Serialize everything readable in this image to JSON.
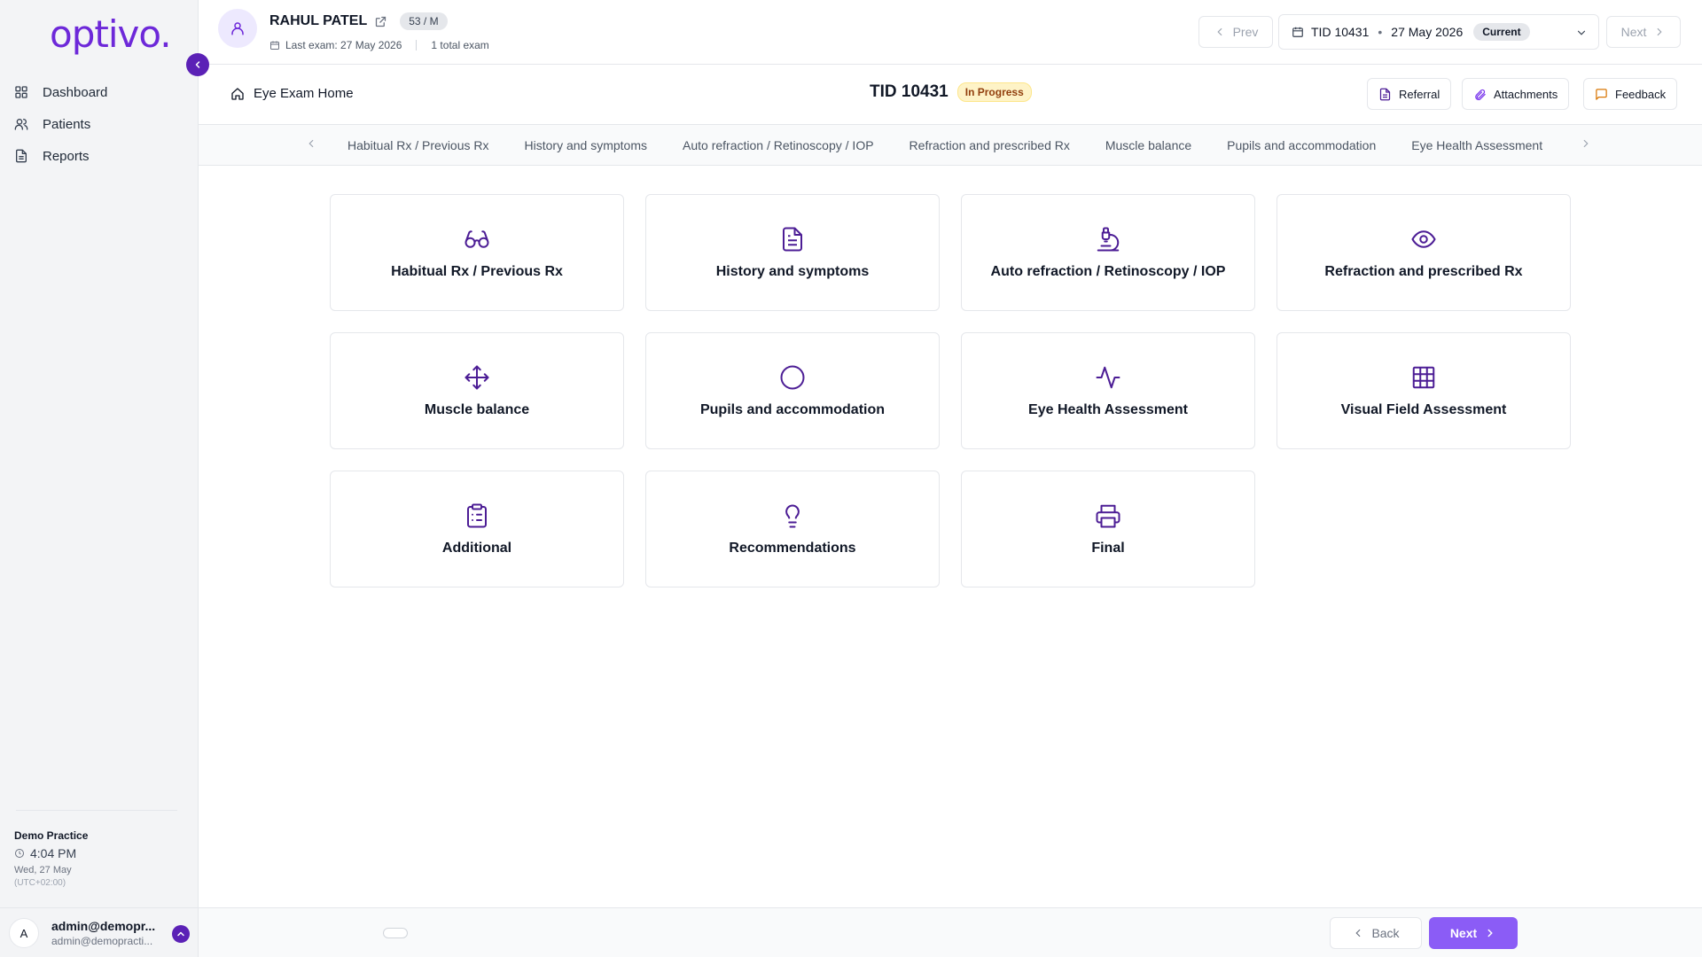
{
  "app": {
    "logo": "optivo."
  },
  "colors": {
    "accent": "#5b21b6",
    "icon": "#4c1d95",
    "primary_button": "#8b5cf6"
  },
  "sidebar": {
    "items": [
      {
        "label": "Dashboard",
        "icon": "grid-icon"
      },
      {
        "label": "Patients",
        "icon": "users-icon"
      },
      {
        "label": "Reports",
        "icon": "file-icon"
      }
    ],
    "practice": {
      "name": "Demo Practice",
      "time": "4:04 PM",
      "date": "Wed, 27 May",
      "tz": "(UTC+02:00)"
    },
    "user": {
      "initial": "A",
      "name": "admin@demopr...",
      "email": "admin@demopracti..."
    }
  },
  "patient": {
    "name": "RAHUL PATEL",
    "age_sex": "53 / M",
    "last_exam": "Last exam: 27 May 2026",
    "total_exams": "1 total exam"
  },
  "exam_nav": {
    "prev_label": "Prev",
    "next_label": "Next",
    "tid": "TID 10431",
    "date": "27 May 2026",
    "current_badge": "Current"
  },
  "exam_header": {
    "home_label": "Eye Exam Home",
    "tid": "TID 10431",
    "status": "In Progress",
    "actions": {
      "referral": "Referral",
      "attachments": "Attachments",
      "feedback": "Feedback"
    }
  },
  "tabs": [
    "Habitual Rx / Previous Rx",
    "History and symptoms",
    "Auto refraction / Retinoscopy / IOP",
    "Refraction and prescribed Rx",
    "Muscle balance",
    "Pupils and accommodation",
    "Eye Health Assessment"
  ],
  "cards": [
    {
      "label": "Habitual Rx / Previous Rx",
      "icon": "glasses-icon"
    },
    {
      "label": "History and symptoms",
      "icon": "document-icon"
    },
    {
      "label": "Auto refraction / Retinoscopy / IOP",
      "icon": "microscope-icon"
    },
    {
      "label": "Refraction and prescribed Rx",
      "icon": "eye-icon"
    },
    {
      "label": "Muscle balance",
      "icon": "move-icon"
    },
    {
      "label": "Pupils and accommodation",
      "icon": "circle-icon"
    },
    {
      "label": "Eye Health Assessment",
      "icon": "activity-icon"
    },
    {
      "label": "Visual Field Assessment",
      "icon": "grid-table-icon"
    },
    {
      "label": "Additional",
      "icon": "clipboard-icon"
    },
    {
      "label": "Recommendations",
      "icon": "lightbulb-icon"
    },
    {
      "label": "Final",
      "icon": "printer-icon"
    }
  ],
  "footer": {
    "back_label": "Back",
    "next_label": "Next"
  }
}
